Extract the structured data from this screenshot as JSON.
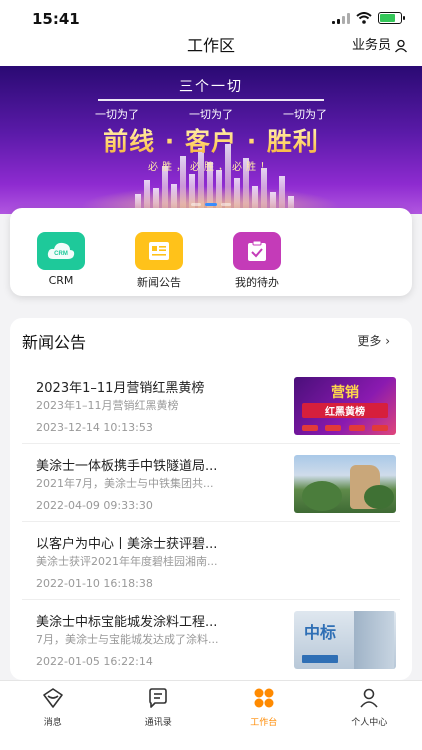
{
  "status": {
    "time": "15:41"
  },
  "nav": {
    "title": "工作区",
    "role": "业务员"
  },
  "banner": {
    "head": "三个一切",
    "subs": [
      "一切为了",
      "一切为了",
      "一切为了"
    ],
    "slogan": "前线 · 客户 · 胜利",
    "cheer": "必胜，必胜，必胜！"
  },
  "apps": [
    {
      "label": "CRM",
      "icon_text": "CRM",
      "icon": "crm-cloud-icon",
      "color": "#1ec99a"
    },
    {
      "label": "新闻公告",
      "icon": "news-icon",
      "color": "#ffc21a"
    },
    {
      "label": "我的待办",
      "icon": "todo-clipboard-icon",
      "color": "#c43bb8"
    }
  ],
  "news": {
    "title": "新闻公告",
    "more": "更多",
    "items": [
      {
        "title": "2023年1–11月营销红黑黄榜",
        "summary": "2023年1–11月营销红黑黄榜",
        "date": "2023-12-14 10:13:53",
        "thumb_text": "营销",
        "thumb_text2": "红黑黄榜"
      },
      {
        "title": "美涂士一体板携手中铁隧道局...",
        "summary": "2021年7月，美涂士与中铁集团共...",
        "date": "2022-04-09 09:33:30"
      },
      {
        "title": "以客户为中心丨美涂士获评碧...",
        "summary": "美涂士获评2021年年度碧桂园湘南...",
        "date": "2022-01-10 16:18:38"
      },
      {
        "title": "美涂士中标宝能城发涂料工程...",
        "summary": "7月，美涂士与宝能城发达成了涂料...",
        "date": "2022-01-05 16:22:14",
        "thumb_text": "中标"
      }
    ]
  },
  "tabs": [
    {
      "label": "消息",
      "icon": "message-icon"
    },
    {
      "label": "通讯录",
      "icon": "contacts-icon"
    },
    {
      "label": "工作台",
      "icon": "workbench-icon"
    },
    {
      "label": "个人中心",
      "icon": "user-icon"
    }
  ],
  "colors": {
    "accent": "#ff8a00",
    "banner_top": "#2a0a73",
    "banner_bottom": "#b157e0"
  }
}
